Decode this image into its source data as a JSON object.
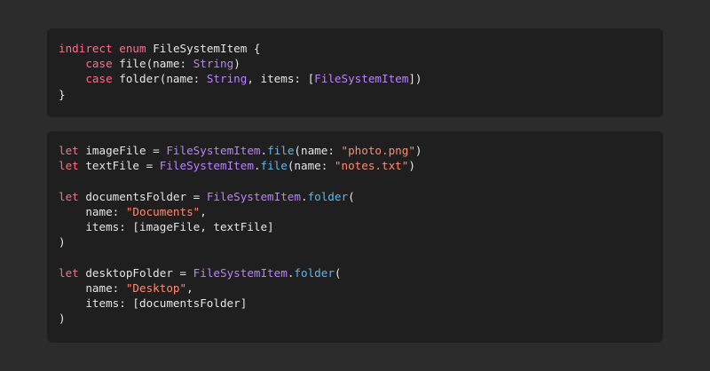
{
  "colors": {
    "page_background": "#2c2c2c",
    "code_background": "#1f1f1f",
    "plain": "#e6e6e6",
    "keyword": "#ff6b8e",
    "type": "#bb81ff",
    "function": "#5cb8f0",
    "string": "#ff8b70"
  },
  "code_blocks": [
    {
      "lines": [
        [
          {
            "t": "indirect",
            "k": "kw"
          },
          {
            "t": " "
          },
          {
            "t": "enum",
            "k": "kw"
          },
          {
            "t": " FileSystemItem {"
          }
        ],
        [
          {
            "t": "    "
          },
          {
            "t": "case",
            "k": "kw"
          },
          {
            "t": " file(name: "
          },
          {
            "t": "String",
            "k": "type"
          },
          {
            "t": ")"
          }
        ],
        [
          {
            "t": "    "
          },
          {
            "t": "case",
            "k": "kw"
          },
          {
            "t": " folder(name: "
          },
          {
            "t": "String",
            "k": "type"
          },
          {
            "t": ", items: ["
          },
          {
            "t": "FileSystemItem",
            "k": "type"
          },
          {
            "t": "])"
          }
        ],
        [
          {
            "t": "}"
          }
        ]
      ]
    },
    {
      "lines": [
        [
          {
            "t": "let",
            "k": "kw"
          },
          {
            "t": " imageFile = "
          },
          {
            "t": "FileSystemItem",
            "k": "type"
          },
          {
            "t": "."
          },
          {
            "t": "file",
            "k": "fn"
          },
          {
            "t": "(name: "
          },
          {
            "t": "\"photo.png\"",
            "k": "str"
          },
          {
            "t": ")"
          }
        ],
        [
          {
            "t": "let",
            "k": "kw"
          },
          {
            "t": " textFile = "
          },
          {
            "t": "FileSystemItem",
            "k": "type"
          },
          {
            "t": "."
          },
          {
            "t": "file",
            "k": "fn"
          },
          {
            "t": "(name: "
          },
          {
            "t": "\"notes.txt\"",
            "k": "str"
          },
          {
            "t": ")"
          }
        ],
        [],
        [
          {
            "t": "let",
            "k": "kw"
          },
          {
            "t": " documentsFolder = "
          },
          {
            "t": "FileSystemItem",
            "k": "type"
          },
          {
            "t": "."
          },
          {
            "t": "folder",
            "k": "fn"
          },
          {
            "t": "("
          }
        ],
        [
          {
            "t": "    name: "
          },
          {
            "t": "\"Documents\"",
            "k": "str"
          },
          {
            "t": ","
          }
        ],
        [
          {
            "t": "    items: [imageFile, textFile]"
          }
        ],
        [
          {
            "t": ")"
          }
        ],
        [],
        [
          {
            "t": "let",
            "k": "kw"
          },
          {
            "t": " desktopFolder = "
          },
          {
            "t": "FileSystemItem",
            "k": "type"
          },
          {
            "t": "."
          },
          {
            "t": "folder",
            "k": "fn"
          },
          {
            "t": "("
          }
        ],
        [
          {
            "t": "    name: "
          },
          {
            "t": "\"Desktop\"",
            "k": "str"
          },
          {
            "t": ","
          }
        ],
        [
          {
            "t": "    items: [documentsFolder]"
          }
        ],
        [
          {
            "t": ")"
          }
        ]
      ]
    }
  ]
}
